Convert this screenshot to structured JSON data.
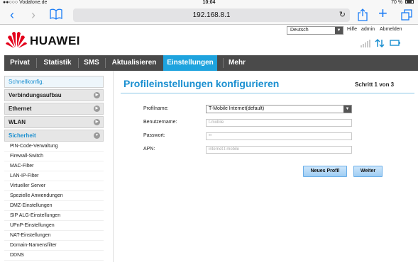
{
  "status_bar": {
    "carrier": "●●○○○ Vodafone.de",
    "time": "10:04",
    "battery": "70 %"
  },
  "browser": {
    "url": "192.168.8.1",
    "icons": [
      "back-icon",
      "forward-icon",
      "bookmarks-icon",
      "reload-icon",
      "share-icon",
      "new-tab-icon",
      "tabs-icon"
    ]
  },
  "header": {
    "brand": "HUAWEI",
    "language": "Deutsch",
    "links": {
      "help": "Hilfe",
      "admin": "admin",
      "logout": "Abmelden"
    }
  },
  "nav": {
    "items": [
      {
        "label": "Privat"
      },
      {
        "label": "Statistik"
      },
      {
        "label": "SMS"
      },
      {
        "label": "Aktualisieren"
      },
      {
        "label": "Einstellungen"
      },
      {
        "label": "Mehr"
      }
    ],
    "active": "Einstellungen"
  },
  "sidebar": {
    "quick": "Schnellkonfig.",
    "sections": [
      {
        "label": "Verbindungsaufbau"
      },
      {
        "label": "Ethernet"
      },
      {
        "label": "WLAN"
      },
      {
        "label": "Sicherheit"
      }
    ],
    "sub_items": [
      "PIN-Code-Verwaltung",
      "Firewall-Switch",
      "MAC-Filter",
      "LAN-IP-Filter",
      "Virtueller Server",
      "Spezielle Anwendungen",
      "DMZ-Einstellungen",
      "SIP ALG-Einstellungen",
      "UPnP-Einstellungen",
      "NAT-Einstellungen",
      "Domain-Namensfilter",
      "DDNS"
    ]
  },
  "main": {
    "title": "Profileinstellungen konfigurieren",
    "step": "Schritt 1 von 3",
    "form": {
      "profile_label": "Profilname:",
      "profile_value": "T-Mobile Internet(default)",
      "username_label": "Benutzername:",
      "username_value": "t-mobile",
      "password_label": "Passwort:",
      "password_value": "••",
      "apn_label": "APN:",
      "apn_value": "internet.t-mobile"
    },
    "buttons": {
      "new_profile": "Neues Profil",
      "next": "Weiter"
    }
  },
  "colors": {
    "accent": "#1ea3de",
    "title_blue": "#1a8fd0",
    "nav_bg": "#4a4a4a",
    "ios_blue": "#1a7cf5",
    "huawei_red": "#e3001b"
  }
}
